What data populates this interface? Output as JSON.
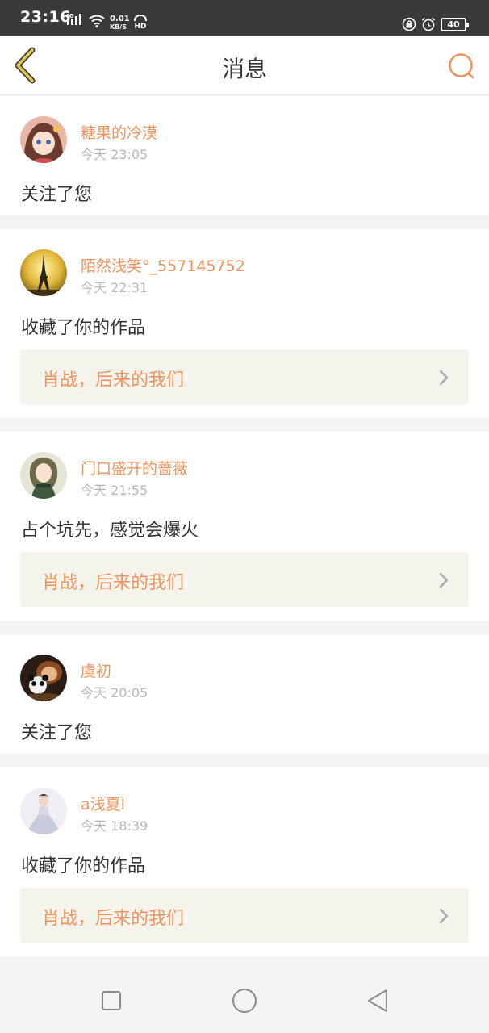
{
  "status_bar": {
    "time": "23:16",
    "network": "4G",
    "speed_value": "0.01",
    "speed_unit": "KB/S",
    "hd": "HD",
    "battery": "40"
  },
  "header": {
    "title": "消息",
    "back_icon": "chevron-left-icon",
    "search_icon": "search-icon"
  },
  "colors": {
    "accent": "#f0935a",
    "back_arrow": "#e2c84a",
    "ref_background": "#f4f3ec"
  },
  "messages": [
    {
      "username": "糖果的冷漠",
      "time": "今天 23:05",
      "action": "关注了您"
    },
    {
      "username": "陌然浅笑°_557145752",
      "time": "今天 22:31",
      "action": "收藏了你的作品",
      "ref_title": "肖战，后来的我们"
    },
    {
      "username": "门口盛开的蔷薇",
      "time": "今天 21:55",
      "action": "占个坑先，感觉会爆火",
      "ref_title": "肖战，后来的我们"
    },
    {
      "username": "虞初",
      "time": "今天 20:05",
      "action": "关注了您"
    },
    {
      "username": "a浅夏l",
      "time": "今天 18:39",
      "action": "收藏了你的作品",
      "ref_title": "肖战，后来的我们"
    }
  ],
  "nav_bar": {
    "icons": [
      "square-recents-icon",
      "circle-home-icon",
      "triangle-back-icon"
    ]
  }
}
